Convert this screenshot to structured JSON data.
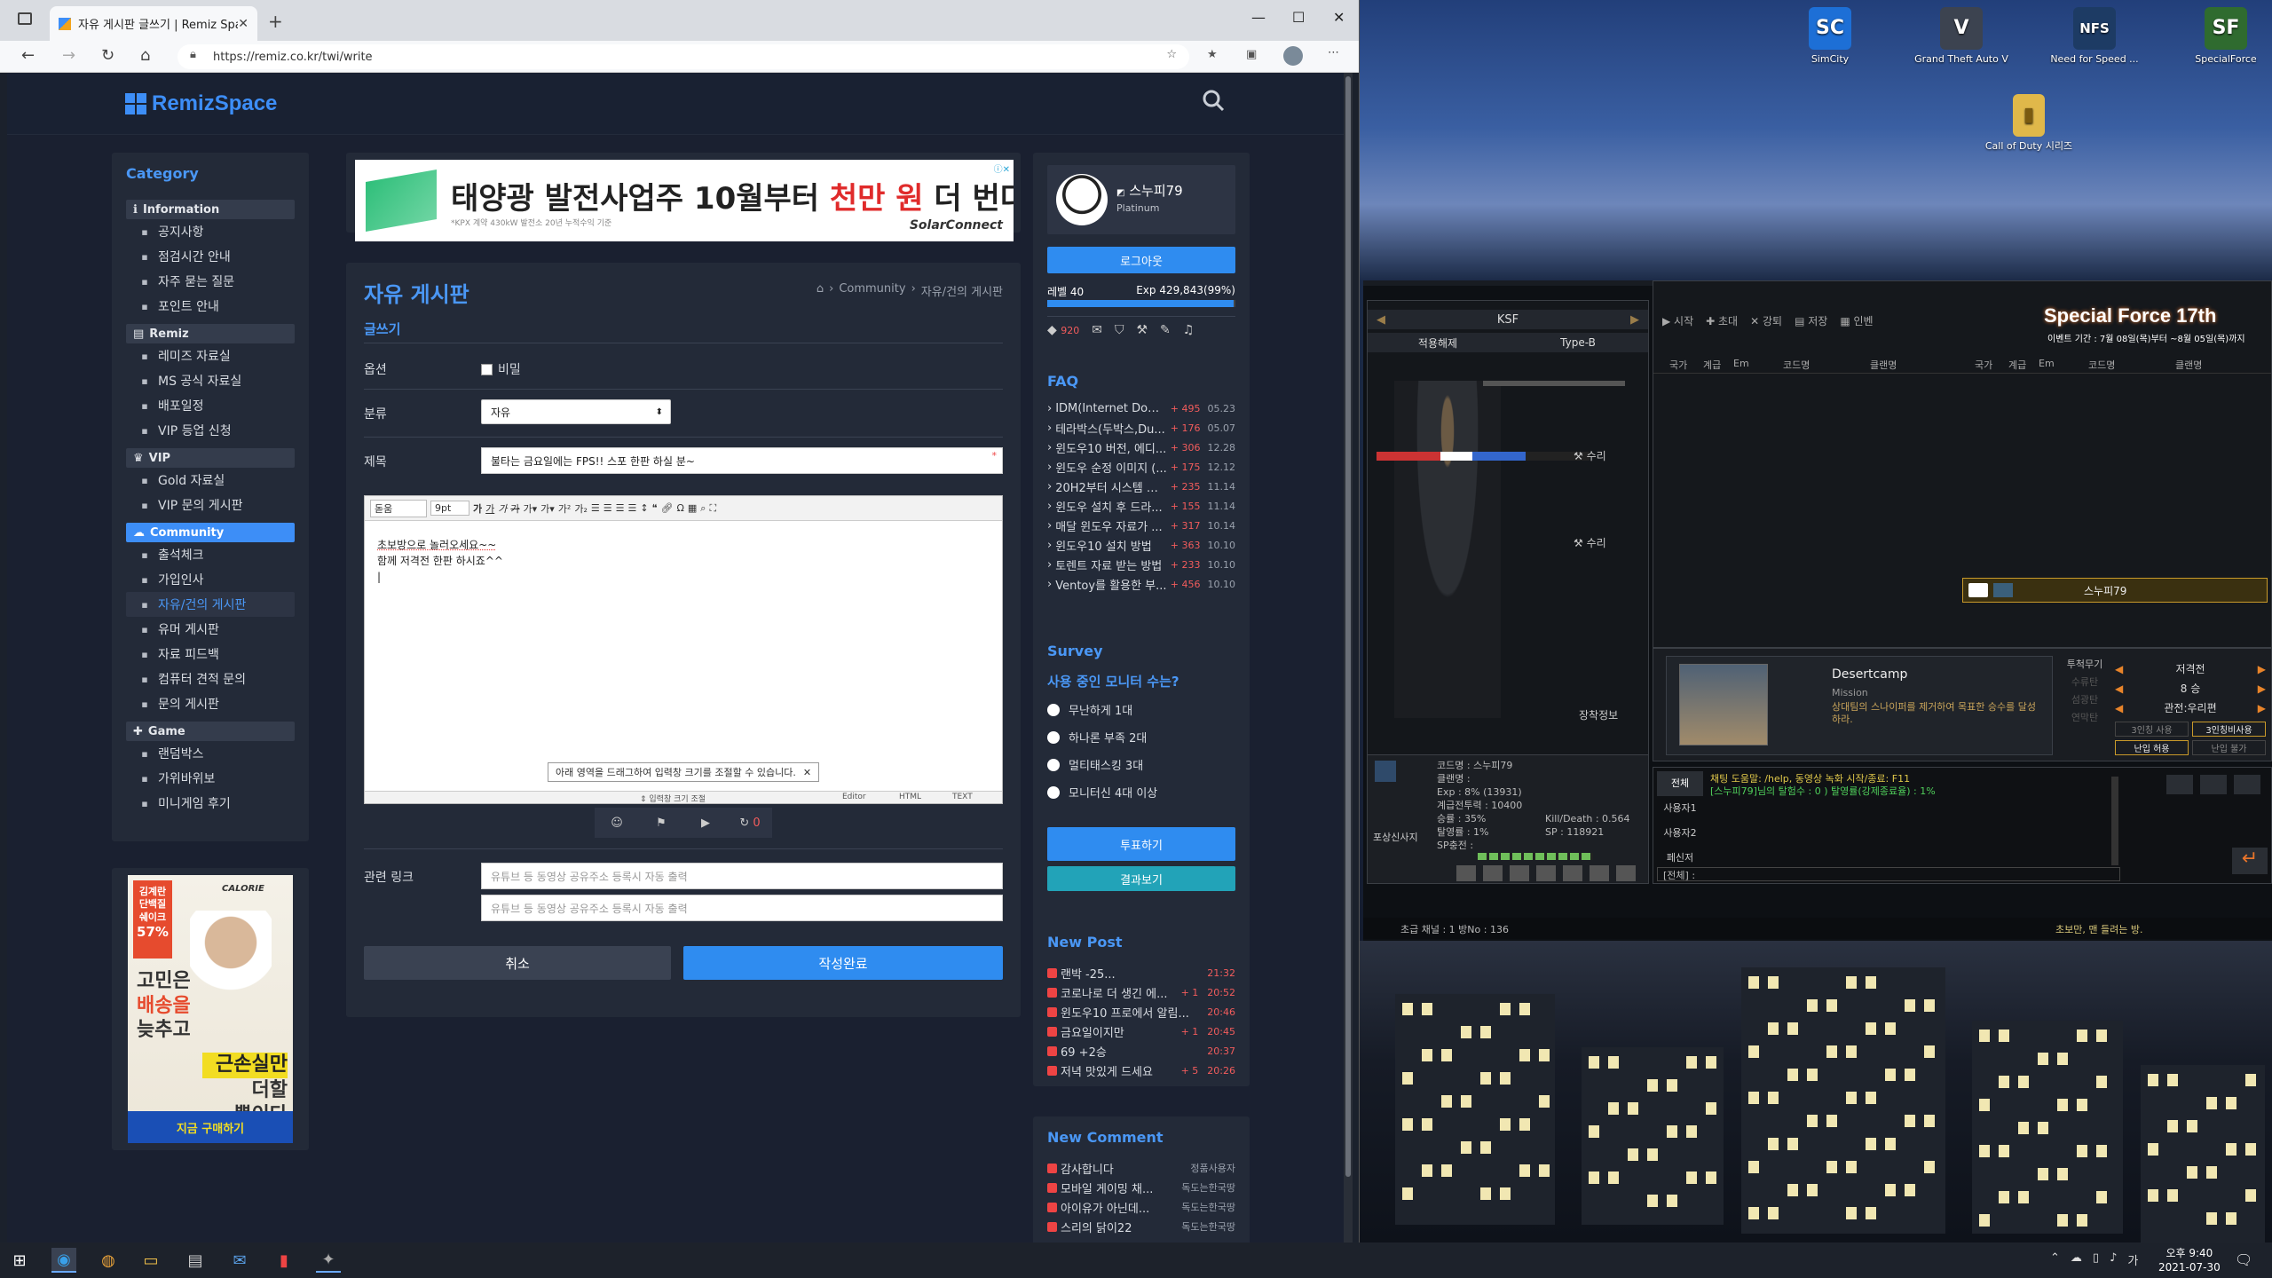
{
  "browser": {
    "tab_title": "자유 게시판 글쓰기 | Remiz Spac",
    "url": "https://remiz.co.kr/twi/write"
  },
  "site": {
    "logo": "RemizSpace",
    "ad_top": {
      "prefix": "태양광 발전사업주 10월부터 ",
      "highlight": "천만 원",
      "suffix": " 더 번다",
      "brand": "SolarConnect",
      "fine": "*KPX 계약 430kW 발전소 20년 누적수익 기준"
    },
    "category_title": "Category",
    "categories": [
      {
        "group": "Information",
        "items": [
          "공지사항",
          "점검시간 안내",
          "자주 묻는 질문",
          "포인트 안내"
        ]
      },
      {
        "group": "Remiz",
        "items": [
          "레미즈 자료실",
          "MS 공식 자료실",
          "배포일정",
          "VIP 등업 신청"
        ]
      },
      {
        "group": "VIP",
        "items": [
          "Gold 자료실",
          "VIP 문의 게시판"
        ]
      },
      {
        "group": "Community",
        "items": [
          "출석체크",
          "가입인사",
          "자유/건의 게시판",
          "유머 게시판",
          "자료 피드백",
          "컴퓨터 견적 문의",
          "문의 게시판"
        ]
      },
      {
        "group": "Game",
        "items": [
          "랜덤박스",
          "가위바위보",
          "미니게임 후기"
        ]
      }
    ],
    "side_ad": {
      "badge1": "김계란",
      "badge2": "단백질",
      "badge3": "쉐이크",
      "pct": "57%",
      "brand": "CALORIE",
      "line1": "고민은",
      "line2": "배송을",
      "line3": "늦추고",
      "line4": "근손실만",
      "line5": "더할",
      "line6": "뿐이다",
      "cta": "지금 구매하기"
    },
    "board": {
      "title": "자유 게시판",
      "breadcrumb": [
        "Community",
        "자유/건의 게시판"
      ],
      "section": "글쓰기",
      "option_label": "옵션",
      "secret_label": "비밀",
      "category_label": "분류",
      "category_value": "자유",
      "subject_label": "제목",
      "subject_value": "불타는 금요일에는 FPS!! 스포 한판 하실 분~",
      "editor_font": "돋움",
      "editor_size": "9pt",
      "body_line1": "초보방으로 놀러오세요~~",
      "body_line2": "함께 저격전 한판 하시죠^^",
      "resize_tip": "아래 영역을 드래그하여 입력창 크기를 조절할 수 있습니다.",
      "resize_handle": "입력창 크기 조절",
      "modes": [
        "Editor",
        "HTML",
        "TEXT"
      ],
      "reload_count": "0",
      "link_label": "관련 링크",
      "link_placeholder": "유튜브 등 동영상 공유주소 등록시 자동 출력",
      "cancel": "취소",
      "submit": "작성완료"
    },
    "profile": {
      "name": "스누피79",
      "grade": "Platinum",
      "logout": "로그아웃",
      "level": "레벨 40",
      "exp": "Exp 429,843(99%)",
      "exp_progress": 0.99,
      "points": "920"
    },
    "faq": {
      "title": "FAQ",
      "items": [
        {
          "t": "IDM(Internet Downl...",
          "n": "+ 495",
          "d": "05.23"
        },
        {
          "t": "테라박스(두박스,Du...",
          "n": "+ 176",
          "d": "05.07"
        },
        {
          "t": "윈도우10 버전, 에디...",
          "n": "+ 306",
          "d": "12.28"
        },
        {
          "t": "윈도우 순정 이미지 (...",
          "n": "+ 175",
          "d": "12.12"
        },
        {
          "t": "20H2부터 시스템 정...",
          "n": "+ 235",
          "d": "11.14"
        },
        {
          "t": "윈도우 설치 후 드라...",
          "n": "+ 155",
          "d": "11.14"
        },
        {
          "t": "매달 윈도우 자료가 ...",
          "n": "+ 317",
          "d": "10.14"
        },
        {
          "t": "윈도우10 설치 방법",
          "n": "+ 363",
          "d": "10.10"
        },
        {
          "t": "토렌트 자료 받는 방법",
          "n": "+ 233",
          "d": "10.10"
        },
        {
          "t": "Ventoy를 활용한 부...",
          "n": "+ 456",
          "d": "10.10"
        }
      ]
    },
    "survey": {
      "title": "Survey",
      "question": "사용 중인 모니터 수는?",
      "options": [
        "무난하게 1대",
        "하나론 부족 2대",
        "멀티태스킹 3대",
        "모니터신 4대 이상"
      ],
      "vote": "투표하기",
      "result": "결과보기"
    },
    "new_post": {
      "title": "New Post",
      "items": [
        {
          "t": "랜박 -25...",
          "n": "",
          "d": "21:32"
        },
        {
          "t": "코로나로 더 생긴 에...",
          "n": "+ 1",
          "d": "20:52"
        },
        {
          "t": "윈도우10 프로에서 알림...",
          "n": "",
          "d": "20:46"
        },
        {
          "t": "금요일이지만",
          "n": "+ 1",
          "d": "20:45"
        },
        {
          "t": "69 +2승",
          "n": "",
          "d": "20:37"
        },
        {
          "t": "저녁 맛있게 드세요",
          "n": "+ 5",
          "d": "20:26"
        }
      ]
    },
    "new_comment": {
      "title": "New Comment",
      "items": [
        {
          "t": "감사합니다",
          "d": "정품사용자"
        },
        {
          "t": "모바일 게이밍 채...",
          "d": "독도는한국땅"
        },
        {
          "t": "아이유가 아닌데...",
          "d": "독도는한국땅"
        },
        {
          "t": "스리의 닭이22",
          "d": "독도는한국땅"
        }
      ]
    }
  },
  "desktop": {
    "icons": [
      {
        "label": "SimCity",
        "glyph": "SC",
        "color": "#1d6fd6"
      },
      {
        "label": "Grand Theft Auto V",
        "glyph": "V",
        "color": "#3c4350"
      },
      {
        "label": "Need for Speed ...",
        "glyph": "NFS",
        "color": "#1d3b64"
      },
      {
        "label": "SpecialForce",
        "glyph": "SF",
        "color": "#2f6b2f"
      },
      {
        "label": "Call of Duty 시리즈",
        "glyph": "▮",
        "color": "#e0b84a"
      }
    ]
  },
  "game": {
    "team": "KSF",
    "subtab1": "적용해제",
    "subtab2": "Type-B",
    "toolbar": [
      "시작",
      "초대",
      "강퇴",
      "저장",
      "인벤"
    ],
    "title": "Special Force 17th",
    "event": "이벤트 기간 : 7월 08일(목)부터 ~8월 05일(목)까지",
    "headers": [
      "국가",
      "계급",
      "Em",
      "코드명",
      "클랜명"
    ],
    "repair": "수리",
    "equip": "장착정보",
    "player": "스누피79",
    "map_name": "Desertcamp",
    "map_mode": "Mission",
    "map_desc": "상대팀의 스나이퍼를 제거하여 목표한 승수를 달성하라.",
    "settings": [
      "저격전",
      "8 승",
      "관전:우리편"
    ],
    "side_btns": [
      "투척무기",
      "수류탄",
      "섬광탄",
      "연막탄"
    ],
    "opt_btns": [
      "3인칭 사용",
      "3인칭비사용",
      "난입 허용",
      "난입 불가"
    ],
    "stats": {
      "code": "코드명 : 스누피79",
      "clan": "클랜명 :",
      "exp": "Exp : 8% (13931)",
      "power": "계급전투력 : 10400",
      "win": "승률 : 35%",
      "kd": "Kill/Death : 0.564",
      "escape": "탈영률 : 1%",
      "sp": "SP : 118921",
      "sp_charge": "SP충전 :",
      "photo": "포상신사지"
    },
    "chat_tabs": [
      "전체",
      "사용자1",
      "사용자2",
      "페신저"
    ],
    "chat1": "채팅 도움말: /help, 동영상 녹화 시작/종료: F11",
    "chat2": "[스누피79]님의 탈험수 : 0 ) 탈영률(강제종료율) : 1%",
    "chat_input": "[전체] :",
    "status_left": "초급   채널 : 1   방No : 136",
    "status_right": "초보만, 맨 들려는 방."
  },
  "taskbar": {
    "time": "오후 9:40",
    "date": "2021-07-30",
    "ime": "가"
  }
}
